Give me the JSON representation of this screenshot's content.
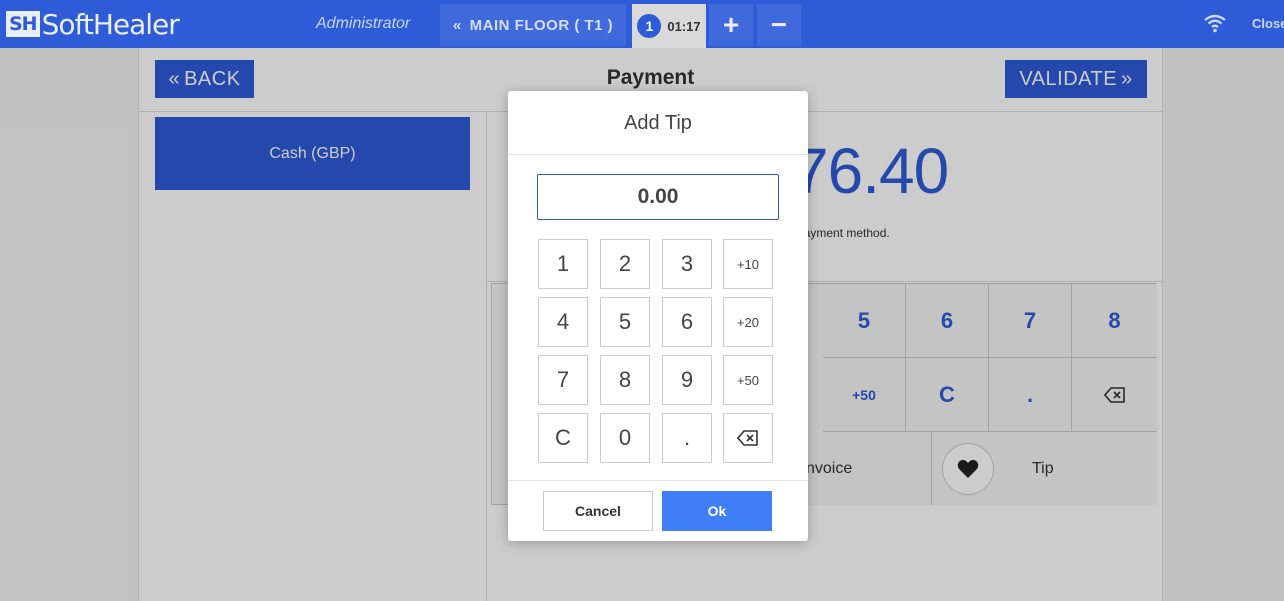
{
  "topbar": {
    "logo_mark": "SH",
    "logo_text": "SoftHealer",
    "user": "Administrator",
    "floor_label": "MAIN FLOOR ( T1 )",
    "order_number": "1",
    "order_time": "01:17",
    "add_label": "+",
    "remove_label": "−",
    "close_label": "Close"
  },
  "payment": {
    "back_label": "BACK",
    "title": "Payment",
    "validate_label": "VALIDATE",
    "method": "Cash (GBP)",
    "amount_visible": "76.40",
    "hint_visible": "a payment method.",
    "numpad_row1": [
      "5",
      "6",
      "7",
      "8"
    ],
    "numpad_row2": [
      "+50",
      "C",
      "."
    ],
    "invoice_label_visible": "nvoice",
    "tip_label": "Tip"
  },
  "modal": {
    "title": "Add Tip",
    "input_value": "0.00",
    "keys": [
      [
        "1",
        "2",
        "3",
        "+10"
      ],
      [
        "4",
        "5",
        "6",
        "+20"
      ],
      [
        "7",
        "8",
        "9",
        "+50"
      ],
      [
        "C",
        "0",
        "."
      ]
    ],
    "cancel_label": "Cancel",
    "ok_label": "Ok"
  },
  "colors": {
    "primary": "#2e5bd6",
    "ok_button": "#3f7ef7"
  }
}
